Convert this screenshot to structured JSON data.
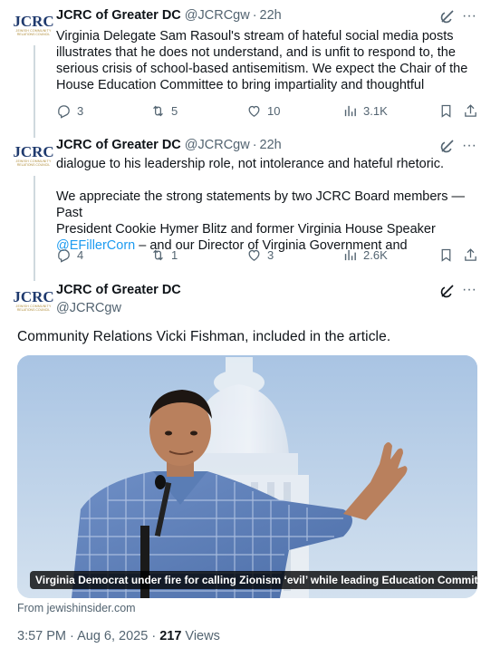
{
  "tweets": [
    {
      "name": "JCRC of Greater DC",
      "handle": "@JCRCgw",
      "time": "22h",
      "text_lines": [
        "Virginia Delegate Sam Rasoul's stream of hateful social media posts",
        "illustrates that he does not understand, and is unfit to respond to, the",
        "serious crisis of school-based antisemitism. We expect the Chair of the",
        "House Education Committee to bring impartiality and thoughtful"
      ],
      "replies": "3",
      "reposts": "5",
      "likes": "10",
      "views": "3.1K"
    },
    {
      "name": "JCRC of Greater DC",
      "handle": "@JCRCgw",
      "time": "22h",
      "text_line1": "dialogue to his leadership role, not intolerance and hateful rhetoric.",
      "text_p2_line1": "We appreciate the strong statements by two JCRC Board members — Past",
      "text_p2_line2": "President Cookie Hymer Blitz and former Virginia House Speaker",
      "mention": "@EFillerCorn",
      "text_p2_line3_rest": " – and our Director of Virginia Government and",
      "replies": "4",
      "reposts": "1",
      "likes": "3",
      "views": "2.6K"
    },
    {
      "name": "JCRC of Greater DC",
      "handle": "@JCRCgw",
      "text": "Community Relations Vicki Fishman, included in the article.",
      "media_caption": "Virginia Democrat under fire for calling Zionism ‘evil’ while leading Education Committee",
      "source": "From jewishinsider.com",
      "timestamp": "3:57 PM · Aug 6, 2025 · ",
      "views_count": "217",
      "views_label": " Views"
    }
  ],
  "avatar": {
    "logo_text": "JCRC",
    "logo_sub1": "JEWISH COMMUNITY",
    "logo_sub2": "RELATIONS COUNCIL"
  },
  "icons": {
    "reply": "reply-icon",
    "repost": "repost-icon",
    "like": "heart-icon",
    "views": "views-chart-icon",
    "bookmark": "bookmark-icon",
    "share": "share-icon",
    "grok": "grok-icon",
    "more": "more-icon"
  },
  "colors": {
    "text": "#0f1419",
    "secondary": "#536471",
    "link": "#1d9bf0",
    "thread_line": "#cfd9de"
  }
}
